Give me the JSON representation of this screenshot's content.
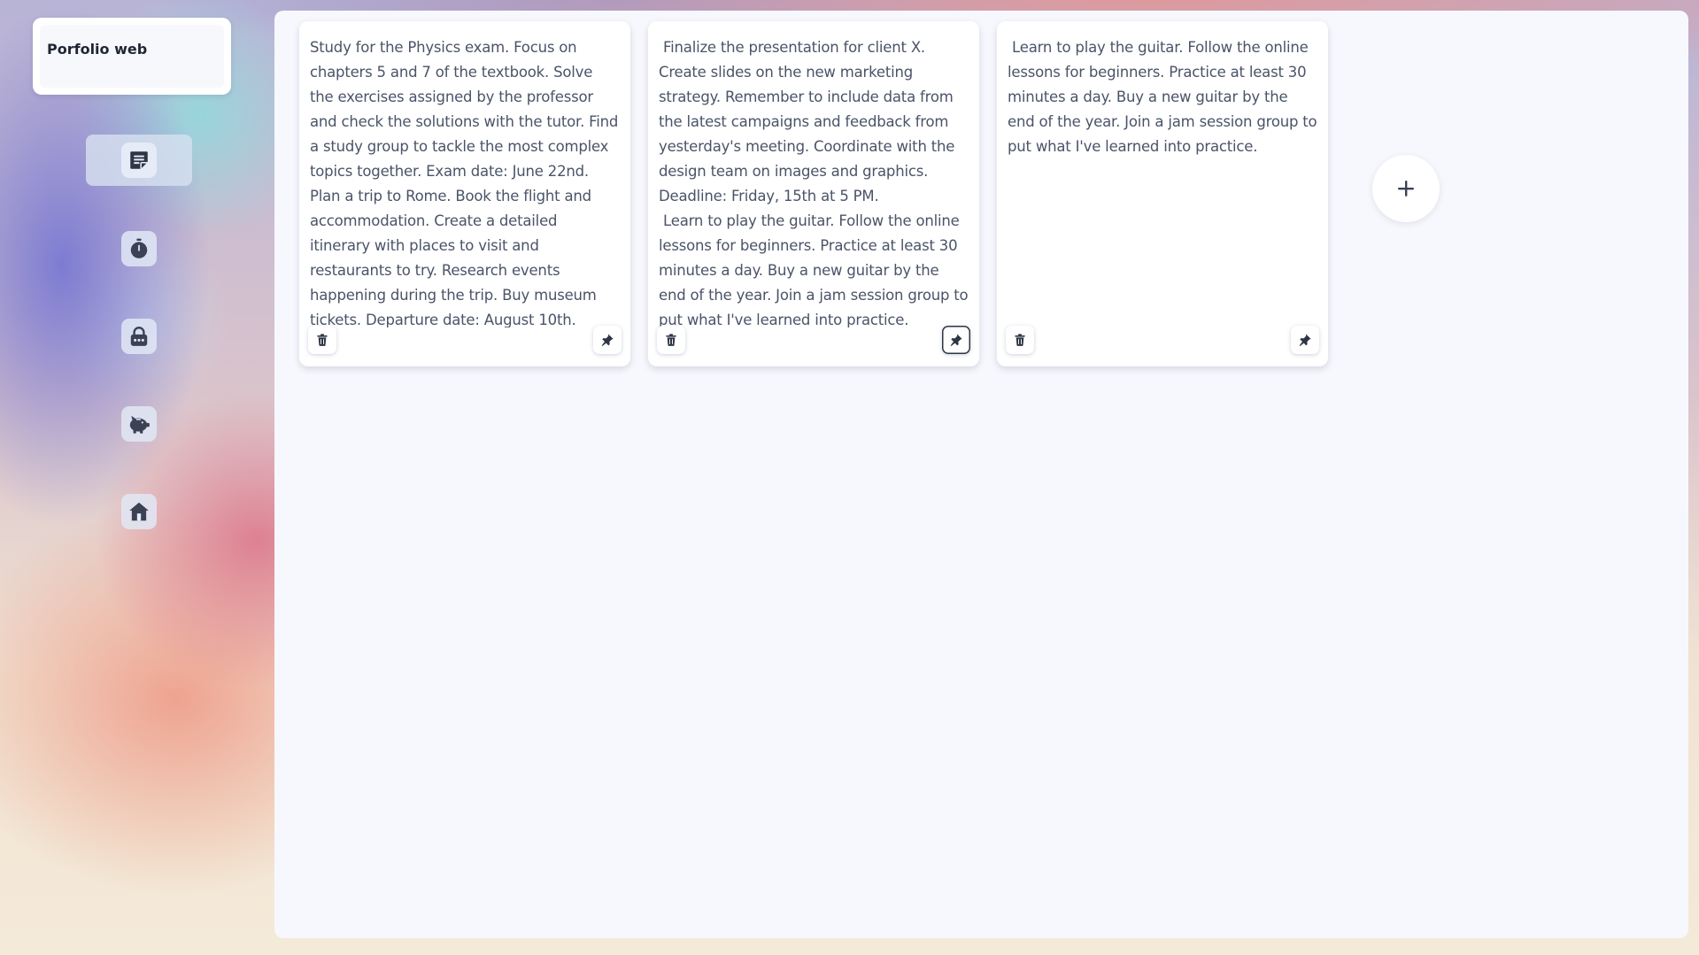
{
  "app": {
    "title": "Porfolio web"
  },
  "sidebar": {
    "items": [
      {
        "name": "notes",
        "icon": "notes-icon",
        "active": true
      },
      {
        "name": "timer",
        "icon": "stopwatch-icon",
        "active": false
      },
      {
        "name": "passwords",
        "icon": "lock-icon",
        "active": false
      },
      {
        "name": "savings",
        "icon": "piggy-bank-icon",
        "active": false
      },
      {
        "name": "home",
        "icon": "home-icon",
        "active": false
      }
    ]
  },
  "notes": [
    {
      "text": "Study for the Physics exam. Focus on chapters 5 and 7 of the textbook. Solve the exercises assigned by the professor and check the solutions with the tutor. Find a study group to tackle the most complex topics together. Exam date: June 22nd.\nPlan a trip to Rome. Book the flight and accommodation. Create a detailed itinerary with places to visit and restaurants to try. Research events happening during the trip. Buy museum tickets. Departure date: August 10th.",
      "pinned": false
    },
    {
      "text": " Finalize the presentation for client X. Create slides on the new marketing strategy. Remember to include data from the latest campaigns and feedback from yesterday's meeting. Coordinate with the design team on images and graphics. Deadline: Friday, 15th at 5 PM.\n Learn to play the guitar. Follow the online lessons for beginners. Practice at least 30 minutes a day. Buy a new guitar by the end of the year. Join a jam session group to put what I've learned into practice.",
      "pinned": true
    },
    {
      "text": " Learn to play the guitar. Follow the online lessons for beginners. Practice at least 30 minutes a day. Buy a new guitar by the end of the year. Join a jam session group to put what I've learned into practice.",
      "pinned": false
    }
  ],
  "icons": {
    "delete": "trash-icon",
    "pin": "pin-icon",
    "add": "plus-icon"
  },
  "colors": {
    "icon": "#3a4254",
    "text": "#4a5468",
    "panel": "#f7f8fd"
  }
}
